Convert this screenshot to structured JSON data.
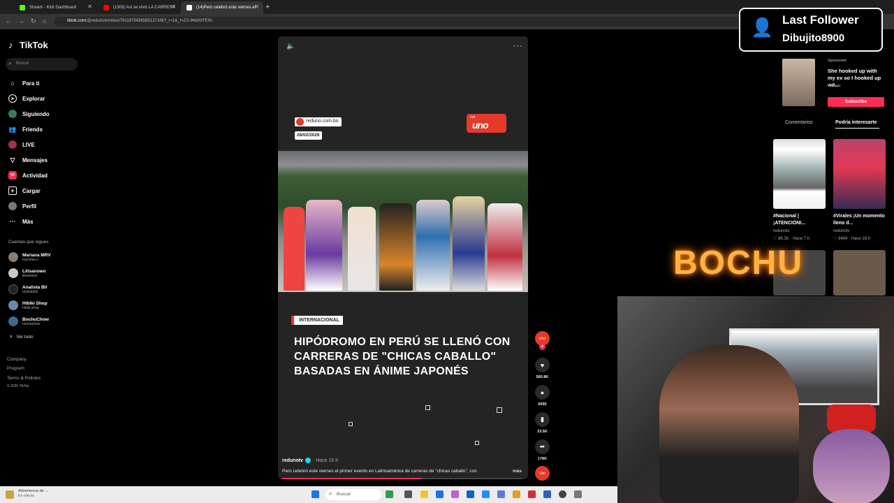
{
  "browser": {
    "tabs": [
      {
        "title": "Stream - Kick Dashboard",
        "color": "#53fc18"
      },
      {
        "title": "(1303) Así se vivió LA CARRERA",
        "color": "#ff0000"
      },
      {
        "title": "(14)Perú celebró este viernes el",
        "color": "#ffffff"
      }
    ],
    "url_prefix": "tiktok.com",
    "url_rest": "/@redunotv/video/7611879436585127188?_r=1&_t=ZS-94tdXrFE9s"
  },
  "sidebar": {
    "logo": "TikTok",
    "search_placeholder": "Buscar",
    "nav": [
      {
        "label": "Para ti",
        "icon": "home-icon"
      },
      {
        "label": "Explorar",
        "icon": "compass-icon"
      },
      {
        "label": "Siguiendo",
        "icon": "following-icon"
      },
      {
        "label": "Friends",
        "icon": "friends-icon"
      },
      {
        "label": "LIVE",
        "icon": "live-icon"
      },
      {
        "label": "Mensajes",
        "icon": "send-icon"
      },
      {
        "label": "Actividad",
        "icon": "activity-icon",
        "badge": "50"
      },
      {
        "label": "Cargar",
        "icon": "upload-icon"
      },
      {
        "label": "Perfil",
        "icon": "profile-icon"
      },
      {
        "label": "Más",
        "icon": "more-icon"
      }
    ],
    "following_title": "Cuentas que sigues",
    "accounts": [
      {
        "name": "Mariana MRV",
        "handle": "marcitax.x"
      },
      {
        "name": "Lilisanowo",
        "handle": "lilisanowo"
      },
      {
        "name": "Analista Bil",
        "handle": "analistabil"
      },
      {
        "name": "Hibiki Shop",
        "handle": "hibiki.shop"
      },
      {
        "name": "BochuChow",
        "handle": "bochuchow"
      }
    ],
    "see_all": "Ver todo",
    "footer": [
      "Company",
      "Program",
      "Terms & Policies",
      "© 2026 TikTok"
    ]
  },
  "video": {
    "source": "reduno.com.bo",
    "date": "28/02/2026",
    "station_small": "red",
    "station_big": "uno",
    "category": "INTERNACIONAL",
    "headline": "HIPÓDROMO EN PERÚ SE LLENÓ CON CARRERAS DE \"CHICAS CABALLO\" BASADAS EN ÁNIME JAPONÉS",
    "channel": "redunotv",
    "time": "· Hace 16 h",
    "description": "Perú celebró este viernes el primer evento en Latinoamérica de carreras de \"chicas caballo\", con",
    "more": "más",
    "progress": 0.58
  },
  "actions": {
    "avatar_label": "Uno",
    "likes": "580.8K",
    "comments": "6995",
    "saves": "33.5K",
    "shares": "178K"
  },
  "overlay": {
    "last_follower_title": "Last Follower",
    "last_follower_name": "Dibujito8900",
    "brand": "BOCHU"
  },
  "right_panel": {
    "sponsored": "Sponsored",
    "ad_text": "She hooked up with my ex so I hooked up wit...",
    "ad_brand": "V vwaxx",
    "subscribe": "Subscribe",
    "tab_comments": "Comentarios",
    "tab_interest": "Podría interesarte",
    "cards": [
      {
        "title": "#Nacional | ¡ATENCIÓNI...",
        "author": "redunotv",
        "likes": "88.2K",
        "time": "· Hace 7 h"
      },
      {
        "title": "#Virales ¡Un momento lleno d...",
        "author": "redunotv",
        "likes": "9484",
        "time": "· Hace 16 h"
      }
    ]
  },
  "taskbar": {
    "warning_title": "Advertencia de ...",
    "warning_sub": "En efecto",
    "search": "Buscar"
  }
}
